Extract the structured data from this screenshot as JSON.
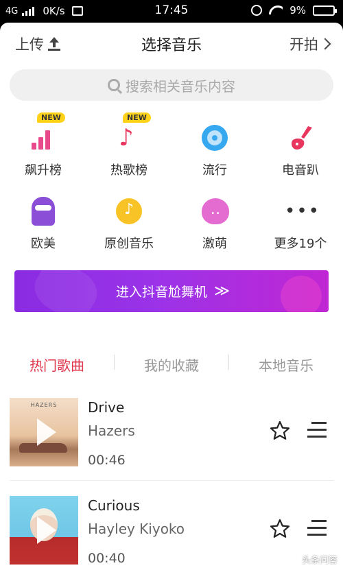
{
  "status_bar": {
    "network": "4G",
    "speed": "0K/s",
    "time": "17:45",
    "battery": "9%"
  },
  "header": {
    "upload_label": "上传",
    "title": "选择音乐",
    "shoot_label": "开拍"
  },
  "search": {
    "placeholder": "搜索相关音乐内容"
  },
  "categories": [
    {
      "label": "飙升榜",
      "badge": "NEW",
      "icon": "trending-chart-icon"
    },
    {
      "label": "热歌榜",
      "badge": "NEW",
      "icon": "hot-music-note-icon"
    },
    {
      "label": "流行",
      "icon": "disc-icon"
    },
    {
      "label": "电音趴",
      "icon": "electric-guitar-icon"
    },
    {
      "label": "欧美",
      "icon": "sunglasses-face-icon"
    },
    {
      "label": "原创音乐",
      "icon": "tiktok-note-icon"
    },
    {
      "label": "激萌",
      "icon": "cute-pig-icon"
    },
    {
      "label": "更多19个",
      "icon": "more-dots-icon"
    }
  ],
  "banner": {
    "label": "进入抖音尬舞机",
    "chevrons": "≫"
  },
  "tabs": [
    {
      "label": "热门歌曲",
      "active": true
    },
    {
      "label": "我的收藏",
      "active": false
    },
    {
      "label": "本地音乐",
      "active": false
    }
  ],
  "songs": [
    {
      "title": "Drive",
      "artist": "Hazers",
      "duration": "00:46",
      "cover_text": "HAZERS"
    },
    {
      "title": "Curious",
      "artist": "Hayley Kiyoko",
      "duration": "00:40"
    }
  ],
  "watermark": "头条问答",
  "colors": {
    "accent_red": "#e0364b",
    "banner_start": "#8a2be2",
    "banner_end": "#c026d3",
    "badge_yellow": "#ffd21a"
  }
}
